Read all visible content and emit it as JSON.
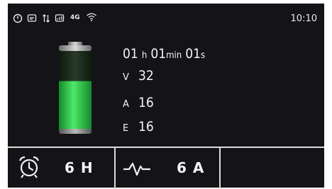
{
  "status_bar": {
    "icons": [
      "power-circle-icon",
      "message-box-icon",
      "data-transfer-icon",
      "signal-box-icon",
      "network-4g-icon",
      "wifi-icon"
    ],
    "network_label": "4G",
    "time": "10:10"
  },
  "battery": {
    "level": 0.62,
    "fill_color": "#2ec84a",
    "body_color": "#1c3a1c"
  },
  "readouts": {
    "duration": {
      "h_value": "01",
      "h_unit": "h",
      "min_value": "01",
      "min_unit": "min",
      "s_value": "01",
      "s_unit": "s"
    },
    "voltage": {
      "label": "V",
      "value": "32"
    },
    "current": {
      "label": "A",
      "value": "16"
    },
    "energy": {
      "label": "E",
      "value": "16"
    }
  },
  "bottom_bar": {
    "timer": {
      "icon": "alarm-clock-icon",
      "value": "6 H"
    },
    "current_setting": {
      "icon": "waveform-icon",
      "value": "6 A"
    }
  }
}
